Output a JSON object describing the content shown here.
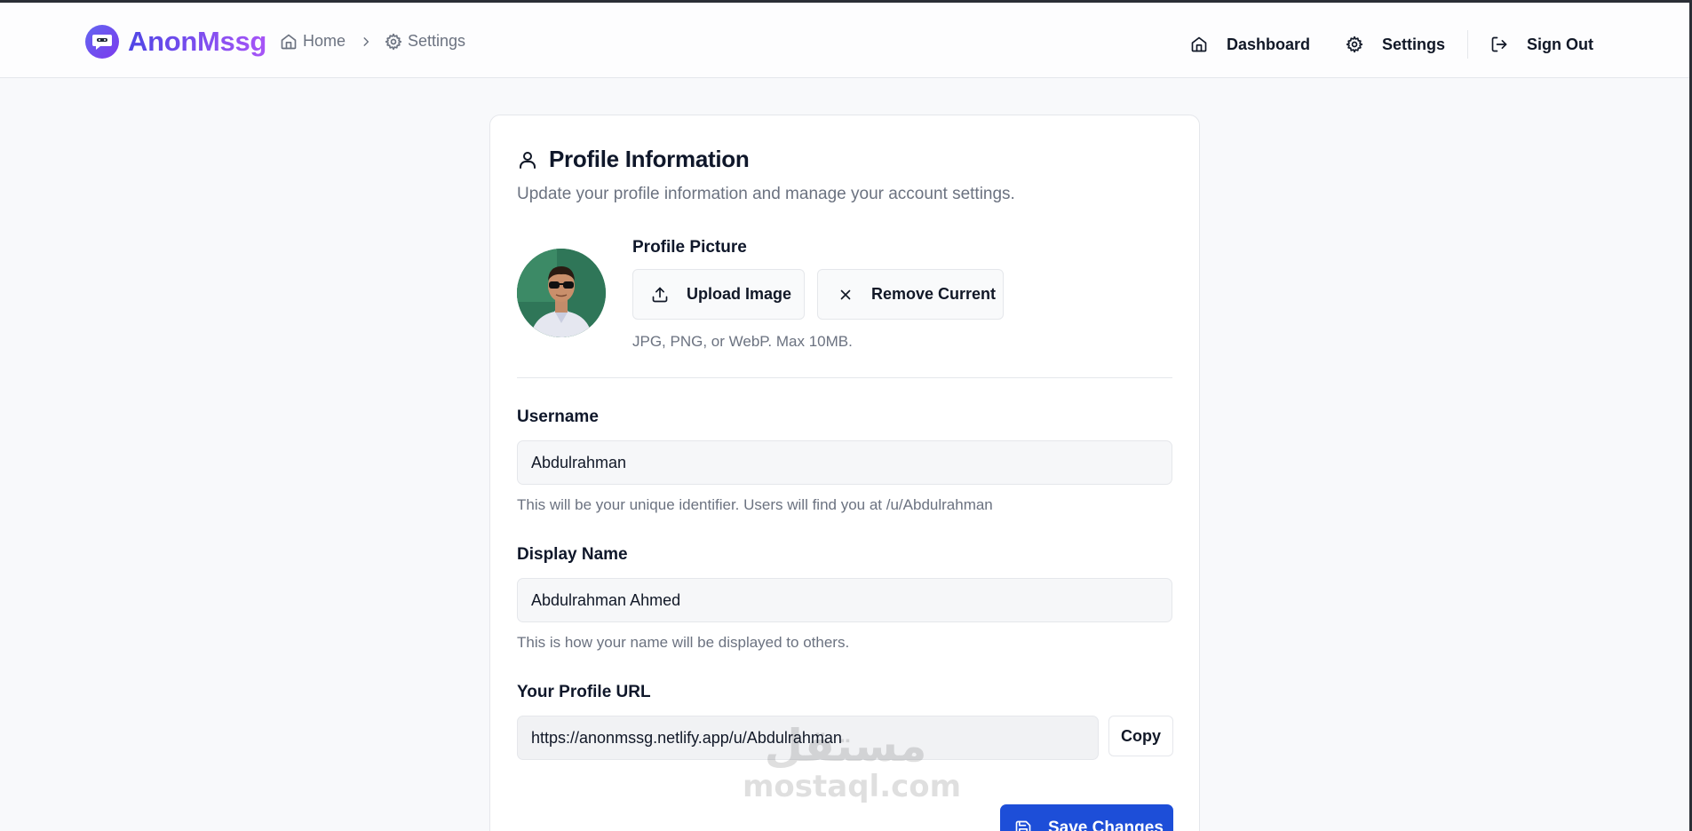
{
  "app": {
    "name": "AnonMssg"
  },
  "breadcrumb": {
    "home": "Home",
    "current": "Settings"
  },
  "nav": {
    "dashboard": "Dashboard",
    "settings": "Settings",
    "sign_out": "Sign Out"
  },
  "card": {
    "title": "Profile Information",
    "subtitle": "Update your profile information and manage your account settings."
  },
  "profile_picture": {
    "label": "Profile Picture",
    "upload_label": "Upload Image",
    "remove_label": "Remove Current",
    "hint": "JPG, PNG, or WebP. Max 10MB."
  },
  "form": {
    "username": {
      "label": "Username",
      "value": "Abdulrahman",
      "hint": "This will be your unique identifier. Users will find you at /u/Abdulrahman"
    },
    "display_name": {
      "label": "Display Name",
      "value": "Abdulrahman Ahmed",
      "hint": "This is how your name will be displayed to others."
    },
    "profile_url": {
      "label": "Your Profile URL",
      "value": "https://anonmssg.netlify.app/u/Abdulrahman",
      "copy_label": "Copy"
    },
    "save_label": "Save Changes"
  },
  "watermark": {
    "arabic": "مستقل",
    "latin": "mostaql.com"
  },
  "colors": {
    "primary": "#1d4ed8",
    "brand_start": "#4f46e5",
    "brand_end": "#a855f7"
  }
}
